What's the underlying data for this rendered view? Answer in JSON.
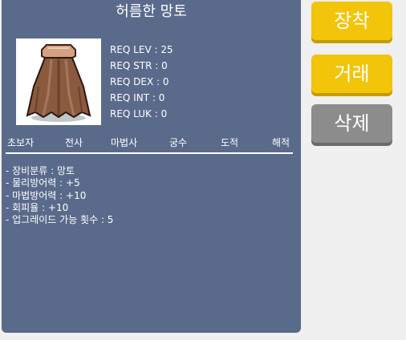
{
  "item": {
    "name": "허름한 망토",
    "icon": "cape-icon",
    "requirements": [
      "REQ LEV : 25",
      "REQ STR : 0",
      "REQ DEX : 0",
      "REQ INT : 0",
      "REQ LUK : 0"
    ],
    "jobs": [
      "초보자",
      "전사",
      "마법사",
      "궁수",
      "도적",
      "해적"
    ],
    "stats": [
      "- 장비분류 : 망토",
      "- 물리방어력 : +5",
      "- 마법방어력 : +10",
      "- 회피율 : +10",
      "- 업그레이드 가능 횟수 : 5"
    ]
  },
  "actions": {
    "equip_label": "장착",
    "trade_label": "거래",
    "delete_label": "삭제"
  },
  "colors": {
    "panel": "#5a6a8b",
    "button_active": "#f2c40a",
    "button_disabled": "#8c8c8c"
  }
}
